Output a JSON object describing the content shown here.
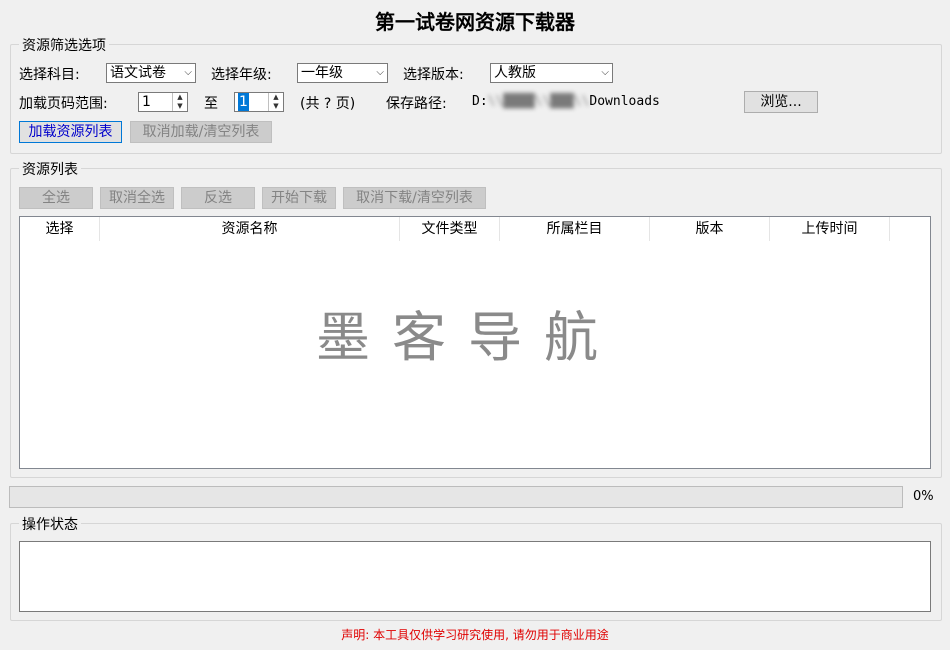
{
  "app": {
    "title": "第一试卷网资源下载器"
  },
  "filter": {
    "legend": "资源筛选选项",
    "subject_label": "选择科目:",
    "subject_value": "语文试卷",
    "grade_label": "选择年级:",
    "grade_value": "一年级",
    "edition_label": "选择版本:",
    "edition_value": "人教版",
    "page_range_label": "加载页码范围:",
    "page_from": "1",
    "to_label": "至",
    "page_to": "1",
    "total_pages": "(共 ? 页)",
    "save_path_label": "保存路径:",
    "save_path_prefix": "D:",
    "save_path_redacted": "\\\\████\\\\███\\\\",
    "save_path_suffix": "Downloads",
    "browse_label": "浏览...",
    "load_list_label": "加载资源列表",
    "cancel_load_label": "取消加载/清空列表"
  },
  "list": {
    "legend": "资源列表",
    "select_all_label": "全选",
    "deselect_all_label": "取消全选",
    "invert_label": "反选",
    "start_download_label": "开始下载",
    "cancel_download_label": "取消下载/清空列表",
    "columns": [
      "选择",
      "资源名称",
      "文件类型",
      "所属栏目",
      "版本",
      "上传时间"
    ],
    "watermark": "墨客导航"
  },
  "progress": {
    "value": 0,
    "text": "0%",
    "fill_color": "#06b025"
  },
  "status": {
    "legend": "操作状态",
    "text": ""
  },
  "disclaimer": "声明: 本工具仅供学习研究使用, 请勿用于商业用途"
}
